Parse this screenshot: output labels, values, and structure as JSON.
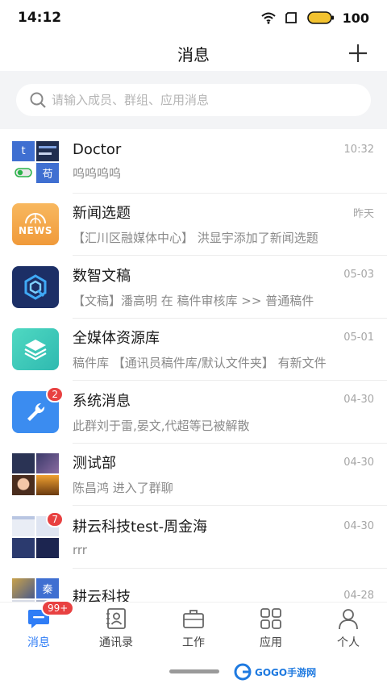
{
  "status_bar": {
    "time": "14:12",
    "battery": "100"
  },
  "header": {
    "title": "消息",
    "add_icon": "plus-icon"
  },
  "search": {
    "placeholder": "请输入成员、群组、应用消息"
  },
  "colors": {
    "accent": "#2f7df6",
    "badge": "#e84141",
    "news": "#f5a84b",
    "digital": "#1c2f66",
    "media": "#3ecfb6",
    "system": "#3b8cf0"
  },
  "chats": [
    {
      "name": "Doctor",
      "time": "10:32",
      "preview": "呜呜呜呜",
      "avatar_chars": [
        "t",
        "苟"
      ]
    },
    {
      "name": "新闻选题",
      "time": "昨天",
      "preview": "【汇川区融媒体中心】 洪显宇添加了新闻选题",
      "avatar_text": "NEWS"
    },
    {
      "name": "数智文稿",
      "time": "05-03",
      "preview": "【文稿】潘高明 在 稿件审核库 >> 普通稿件"
    },
    {
      "name": "全媒体资源库",
      "time": "05-01",
      "preview": "稿件库 【通讯员稿件库/默认文件夹】 有新文件"
    },
    {
      "name": "系统消息",
      "time": "04-30",
      "preview": "此群刘于雷,晏文,代超等已被解散",
      "badge": "2"
    },
    {
      "name": "测试部",
      "time": "04-30",
      "preview": "陈昌鸿 进入了群聊"
    },
    {
      "name": "耕云科技test-周金海",
      "time": "04-30",
      "preview": "rrr",
      "badge": "7"
    },
    {
      "name": "耕云科技",
      "time": "04-28",
      "preview": "",
      "avatar_chars": [
        "秦"
      ]
    }
  ],
  "tabs": [
    {
      "label": "消息",
      "icon": "message-icon",
      "badge": "99+",
      "active": true
    },
    {
      "label": "通讯录",
      "icon": "contacts-icon"
    },
    {
      "label": "工作",
      "icon": "briefcase-icon"
    },
    {
      "label": "应用",
      "icon": "apps-grid-icon"
    },
    {
      "label": "个人",
      "icon": "person-icon"
    }
  ],
  "watermark": {
    "text": "GOGO手游网"
  }
}
